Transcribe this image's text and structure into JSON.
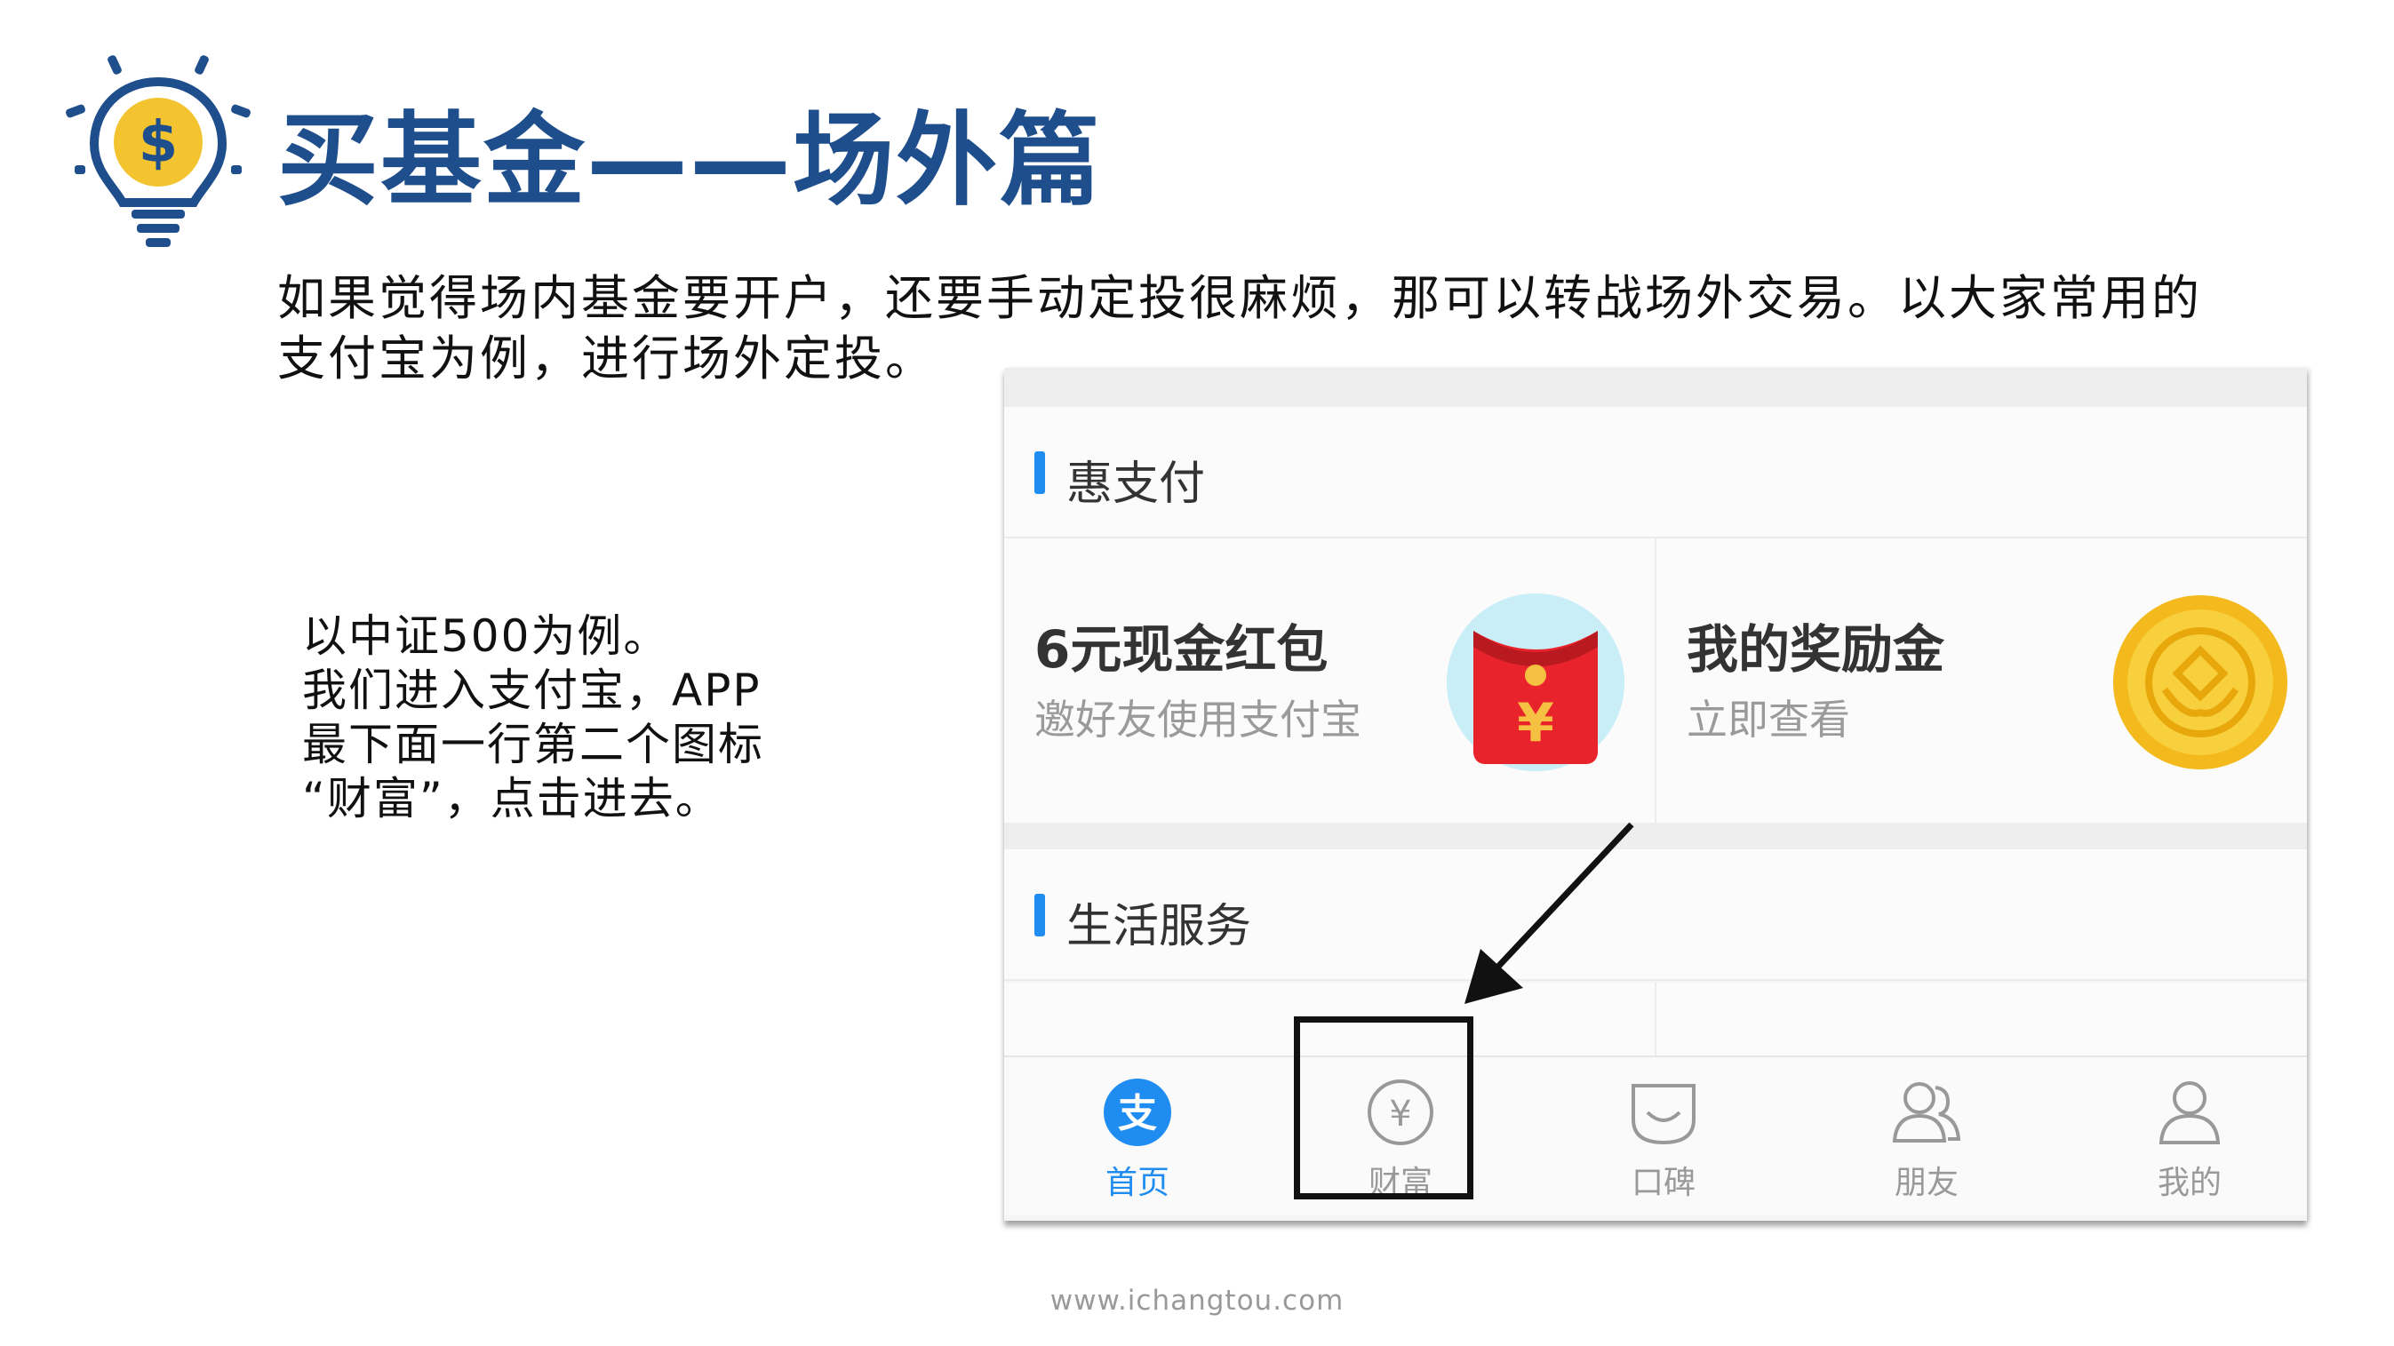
{
  "slide": {
    "title": "买基金——场外篇",
    "intro": [
      "如果觉得场内基金要开户，还要手动定投很麻烦，那可以转战场外交易。以大家常用的",
      "支付宝为例，进行场外定投。"
    ],
    "steps": [
      "以中证500为例。",
      "我们进入支付宝，APP",
      "最下面一行第二个图标",
      "“财富”，点击进去。"
    ],
    "footer": "www.ichangtou.com",
    "logo_icon": "lightbulb-dollar-icon",
    "arrow_icon": "arrow-pointer-icon"
  },
  "app": {
    "sections": [
      {
        "title": "惠支付",
        "cards": [
          {
            "title": "6元现金红包",
            "subtitle": "邀好友使用支付宝",
            "icon": "red-envelope-icon"
          },
          {
            "title": "我的奖励金",
            "subtitle": "立即查看",
            "icon": "gold-coin-icon"
          }
        ]
      },
      {
        "title": "生活服务",
        "cards": []
      }
    ],
    "tabs": [
      {
        "label": "首页",
        "icon": "alipay-home-icon",
        "active": true
      },
      {
        "label": "财富",
        "icon": "yuan-coin-icon",
        "active": false
      },
      {
        "label": "口碑",
        "icon": "koubei-bag-icon",
        "active": false
      },
      {
        "label": "朋友",
        "icon": "friends-icon",
        "active": false
      },
      {
        "label": "我的",
        "icon": "person-icon",
        "active": false
      }
    ]
  },
  "colors": {
    "title": "#1f4e8c",
    "accent_blue": "#1e8cf0",
    "envelope_red": "#e8232b",
    "coin_gold": "#f5c518",
    "highlight_border": "#111111"
  }
}
